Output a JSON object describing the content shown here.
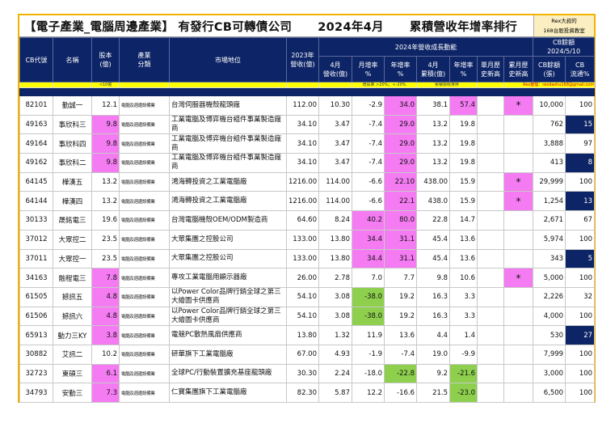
{
  "title": "【電子產業_電腦周邊產業】 有發行CB可轉債公司      2024年4月      累積營收年增率排行",
  "brand": {
    "line1": "Rex大叔的",
    "line2": "168台股投資教室"
  },
  "headers": {
    "cb_code": "CB代號",
    "name": "名稱",
    "capital": "股本\n(億)",
    "industry": "產業\n分類",
    "market": "市場地位",
    "rev2023": "2023年\n營收(億)",
    "growth_group": "2024年營收成長動能",
    "cb_group": "CB餘額\n2024/5/10",
    "apr_rev": "4月\n營收(億)",
    "mom": "月增率\n%",
    "yoy": "年增率\n%",
    "apr_cum": "4月\n累積(億)",
    "cum_yoy": "年增率\n%",
    "month_high": "單月歷\n史新高",
    "cum_high": "累月歷\n史新高",
    "cb_balance": "CB餘額\n(張)",
    "cb_flow": "CB\n流通%"
  },
  "legend": {
    "capital": "<10億",
    "growth": "增長率 >20%；<-20%",
    "sort": "累積營收排序",
    "contact": "Rex整理：rexdashu168@gmail.com"
  },
  "colors": {
    "navy": "#0d2466",
    "pink": "#f47bf2",
    "green": "#8ed04e",
    "yellow": "#ffff00",
    "border": "#f0b400"
  },
  "rows": [
    {
      "code": "82101",
      "name": "勤誠一",
      "capital": "12.1",
      "industry": "電腦及週邊設備業",
      "market": "台灣伺服器機殼龍頭廠",
      "rev2023": "112.00",
      "apr_rev": "10.30",
      "mom": "-2.9",
      "yoy": "34.0",
      "apr_cum": "38.1",
      "cum_yoy": "57.4",
      "month_high": "",
      "cum_high": "*",
      "cb_balance": "10,000",
      "cb_flow": "100"
    },
    {
      "code": "49163",
      "name": "事欣科三",
      "capital": "9.8",
      "industry": "電腦及週邊設備業",
      "market": "工業電腦及博弈機台組件事業製造廠商",
      "rev2023": "34.10",
      "apr_rev": "3.47",
      "mom": "-7.4",
      "yoy": "29.0",
      "apr_cum": "13.2",
      "cum_yoy": "19.8",
      "month_high": "",
      "cum_high": "",
      "cb_balance": "762",
      "cb_flow": "15"
    },
    {
      "code": "49164",
      "name": "事欣科四",
      "capital": "9.8",
      "industry": "電腦及週邊設備業",
      "market": "工業電腦及博弈機台組件事業製造廠商",
      "rev2023": "34.10",
      "apr_rev": "3.47",
      "mom": "-7.4",
      "yoy": "29.0",
      "apr_cum": "13.2",
      "cum_yoy": "19.8",
      "month_high": "",
      "cum_high": "",
      "cb_balance": "3,888",
      "cb_flow": "97"
    },
    {
      "code": "49162",
      "name": "事欣科二",
      "capital": "9.8",
      "industry": "電腦及週邊設備業",
      "market": "工業電腦及博弈機台組件事業製造廠商",
      "rev2023": "34.10",
      "apr_rev": "3.47",
      "mom": "-7.4",
      "yoy": "29.0",
      "apr_cum": "13.2",
      "cum_yoy": "19.8",
      "month_high": "",
      "cum_high": "",
      "cb_balance": "413",
      "cb_flow": "8"
    },
    {
      "code": "64145",
      "name": "樺漢五",
      "capital": "13.2",
      "industry": "電腦及週邊設備業",
      "market": "鴻海轉投資之工業電腦廠",
      "rev2023": "1216.00",
      "apr_rev": "114.00",
      "mom": "-6.6",
      "yoy": "22.10",
      "apr_cum": "438.00",
      "cum_yoy": "15.9",
      "month_high": "",
      "cum_high": "*",
      "cb_balance": "29,999",
      "cb_flow": "100"
    },
    {
      "code": "64144",
      "name": "樺漢四",
      "capital": "13.2",
      "industry": "電腦及週邊設備業",
      "market": "鴻海轉投資之工業電腦廠",
      "rev2023": "1216.00",
      "apr_rev": "114.00",
      "mom": "-6.6",
      "yoy": "22.1",
      "apr_cum": "438.0",
      "cum_yoy": "15.9",
      "month_high": "",
      "cum_high": "*",
      "cb_balance": "1,254",
      "cb_flow": "13"
    },
    {
      "code": "30133",
      "name": "晟銘電三",
      "capital": "19.6",
      "industry": "電腦及週邊設備業",
      "market": "台灣電腦機殼OEM/ODM製造商",
      "rev2023": "64.60",
      "apr_rev": "8.24",
      "mom": "40.2",
      "yoy": "80.0",
      "apr_cum": "22.8",
      "cum_yoy": "14.7",
      "month_high": "",
      "cum_high": "",
      "cb_balance": "2,671",
      "cb_flow": "67"
    },
    {
      "code": "37012",
      "name": "大眾控二",
      "capital": "23.5",
      "industry": "電腦及週邊設備業",
      "market": "大眾集團之控股公司",
      "rev2023": "133.00",
      "apr_rev": "13.80",
      "mom": "34.4",
      "yoy": "31.1",
      "apr_cum": "45.4",
      "cum_yoy": "13.6",
      "month_high": "",
      "cum_high": "",
      "cb_balance": "5,974",
      "cb_flow": "100"
    },
    {
      "code": "37011",
      "name": "大眾控一",
      "capital": "23.5",
      "industry": "電腦及週邊設備業",
      "market": "大眾集團之控股公司",
      "rev2023": "133.00",
      "apr_rev": "13.80",
      "mom": "34.4",
      "yoy": "31.1",
      "apr_cum": "45.4",
      "cum_yoy": "13.6",
      "month_high": "",
      "cum_high": "",
      "cb_balance": "343",
      "cb_flow": "5"
    },
    {
      "code": "34163",
      "name": "融程電三",
      "capital": "7.8",
      "industry": "電腦及週邊設備業",
      "market": "專攻工業電腦用顯示器廠",
      "rev2023": "26.00",
      "apr_rev": "2.78",
      "mom": "7.0",
      "yoy": "7.7",
      "apr_cum": "9.8",
      "cum_yoy": "10.6",
      "month_high": "",
      "cum_high": "*",
      "cb_balance": "5,000",
      "cb_flow": "100"
    },
    {
      "code": "61505",
      "name": "撼訊五",
      "capital": "4.8",
      "industry": "電腦及週邊設備業",
      "market": "以Power Color品牌行銷全球之第三大繪圖卡供應商",
      "rev2023": "54.10",
      "apr_rev": "3.08",
      "mom": "-38.0",
      "yoy": "19.2",
      "apr_cum": "16.3",
      "cum_yoy": "3.3",
      "month_high": "",
      "cum_high": "",
      "cb_balance": "2,226",
      "cb_flow": "32"
    },
    {
      "code": "61506",
      "name": "撼訊六",
      "capital": "4.8",
      "industry": "電腦及週邊設備業",
      "market": "以Power Color品牌行銷全球之第三大繪圖卡供應商",
      "rev2023": "54.10",
      "apr_rev": "3.08",
      "mom": "-38.0",
      "yoy": "19.2",
      "apr_cum": "16.3",
      "cum_yoy": "3.3",
      "month_high": "",
      "cum_high": "",
      "cb_balance": "4,000",
      "cb_flow": "100"
    },
    {
      "code": "65913",
      "name": "動力三KY",
      "capital": "3.8",
      "industry": "電腦及週邊設備業",
      "market": "電競PC散熱風扇供應商",
      "rev2023": "13.80",
      "apr_rev": "1.32",
      "mom": "11.9",
      "yoy": "13.6",
      "apr_cum": "4.4",
      "cum_yoy": "1.4",
      "month_high": "",
      "cum_high": "",
      "cb_balance": "530",
      "cb_flow": "27"
    },
    {
      "code": "30882",
      "name": "艾訊二",
      "capital": "10.2",
      "industry": "電腦及週邊設備業",
      "market": "研華旗下工業電腦廠",
      "rev2023": "67.00",
      "apr_rev": "4.93",
      "mom": "-1.9",
      "yoy": "-7.4",
      "apr_cum": "19.0",
      "cum_yoy": "-9.9",
      "month_high": "",
      "cum_high": "",
      "cb_balance": "7,999",
      "cb_flow": "100"
    },
    {
      "code": "32723",
      "name": "東碩三",
      "capital": "6.1",
      "industry": "電腦及週邊設備業",
      "market": "全球PC/行動裝置擴充基座龍頭廠",
      "rev2023": "30.30",
      "apr_rev": "2.24",
      "mom": "-18.0",
      "yoy": "-22.8",
      "apr_cum": "9.2",
      "cum_yoy": "-21.6",
      "month_high": "",
      "cum_high": "",
      "cb_balance": "3,000",
      "cb_flow": "100"
    },
    {
      "code": "34793",
      "name": "安勤三",
      "capital": "7.3",
      "industry": "電腦及週邊設備業",
      "market": "仁寶集團旗下工業電腦廠",
      "rev2023": "82.30",
      "apr_rev": "5.87",
      "mom": "12.2",
      "yoy": "-16.6",
      "apr_cum": "21.5",
      "cum_yoy": "-23.0",
      "month_high": "",
      "cum_high": "",
      "cb_balance": "6,500",
      "cb_flow": "100"
    }
  ]
}
